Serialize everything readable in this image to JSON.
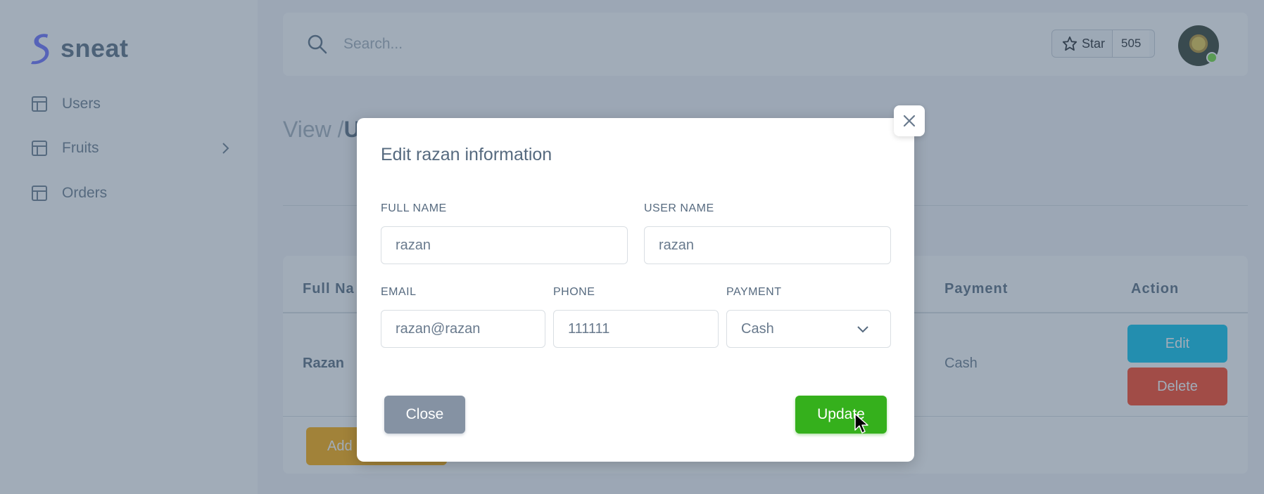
{
  "brand": {
    "name": "sneat",
    "color": "#696cff"
  },
  "sidebar": {
    "items": [
      {
        "label": "Users",
        "icon": "layout-icon"
      },
      {
        "label": "Fruits",
        "icon": "layout-icon",
        "has_submenu": true
      },
      {
        "label": "Orders",
        "icon": "layout-icon"
      }
    ]
  },
  "navbar": {
    "search_placeholder": "Search...",
    "github_star_label": "Star",
    "github_star_count": "505"
  },
  "breadcrumb": {
    "prefix": "View /",
    "current": "U"
  },
  "table": {
    "headers": {
      "full_name": "Full Na",
      "payment": "Payment",
      "action": "Action"
    },
    "rows": [
      {
        "full_name": "Razan",
        "payment": "Cash"
      }
    ],
    "edit_label": "Edit",
    "delete_label": "Delete",
    "add_label": "Add"
  },
  "modal": {
    "title": "Edit razan information",
    "fields": {
      "full_name": {
        "label": "FULL NAME",
        "value": "razan"
      },
      "user_name": {
        "label": "USER NAME",
        "value": "razan"
      },
      "email": {
        "label": "EMAIL",
        "value": "razan@razan"
      },
      "phone": {
        "label": "PHONE",
        "value": "111111"
      },
      "payment": {
        "label": "PAYMENT",
        "value": "Cash"
      }
    },
    "close_label": "Close",
    "update_label": "Update"
  },
  "colors": {
    "primary": "#696cff",
    "info": "#03c3ec",
    "danger": "#ff3e1d",
    "warning": "#ffab00",
    "secondary": "#8592a3",
    "success": "#35b01c"
  }
}
